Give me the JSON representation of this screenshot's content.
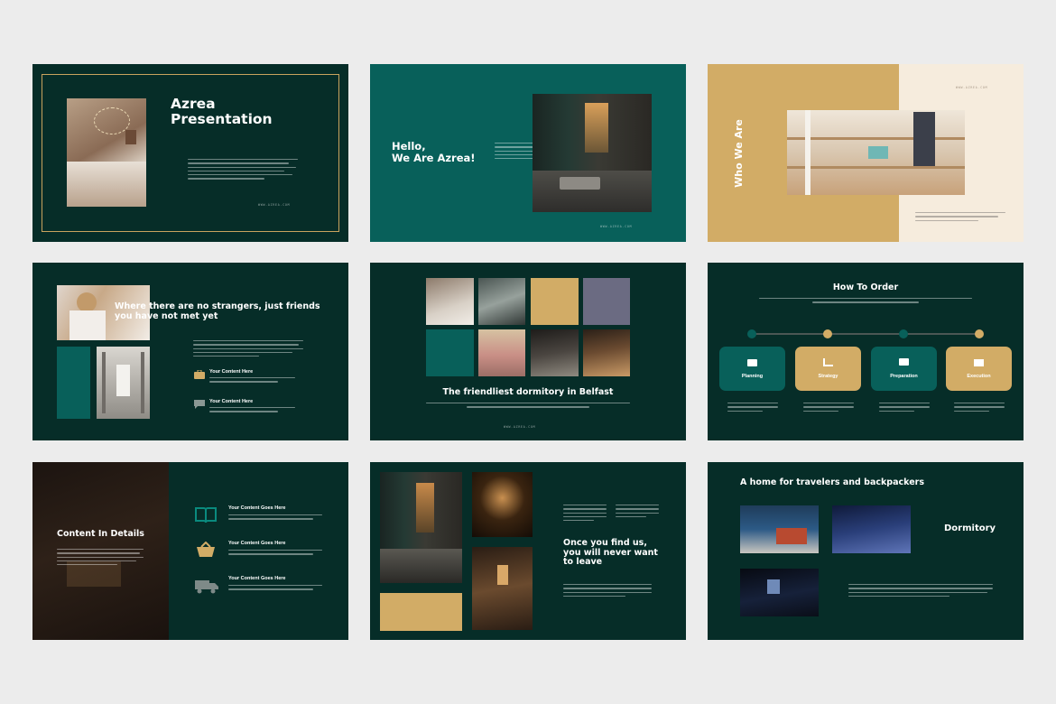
{
  "slides": {
    "s1": {
      "title_line1": "Azrea",
      "title_line2": "Presentation",
      "url": "WWW.AZREA.COM"
    },
    "s2": {
      "title_line1": "Hello,",
      "title_line2": "We Are Azrea!",
      "url": "WWW.AZREA.COM"
    },
    "s3": {
      "vertical_title": "Who We Are",
      "url": "WWW.AZREA.COM"
    },
    "s4": {
      "title_line1": "Where there are no strangers, just friends",
      "title_line2": "you have not met yet",
      "item1_title": "Your Content Here",
      "item2_title": "Your Content Here"
    },
    "s5": {
      "title": "The friendliest dormitory in Belfast",
      "url": "WWW.AZREA.COM"
    },
    "s6": {
      "title": "How To Order",
      "steps": [
        "Planning",
        "Strategy",
        "Preparation",
        "Execution"
      ]
    },
    "s7": {
      "title": "Content In Details",
      "items": [
        "Your Content Goes Here",
        "Your Content Goes Here",
        "Your Content Goes Here"
      ]
    },
    "s8": {
      "title_line1": "Once you find us,",
      "title_line2": "you will never want",
      "title_line3": "to leave"
    },
    "s9": {
      "title": "A home for travelers and backpackers",
      "label": "Dormitory"
    }
  },
  "colors": {
    "dark_teal": "#062d28",
    "teal": "#08605a",
    "gold": "#d2ac66",
    "cream": "#f6ecdd",
    "slate": "#6b6b82"
  },
  "icons": [
    "briefcase-icon",
    "chat-icon",
    "folder-icon",
    "chart-icon",
    "monitor-icon",
    "mail-icon",
    "book-icon",
    "basket-icon",
    "truck-icon"
  ]
}
